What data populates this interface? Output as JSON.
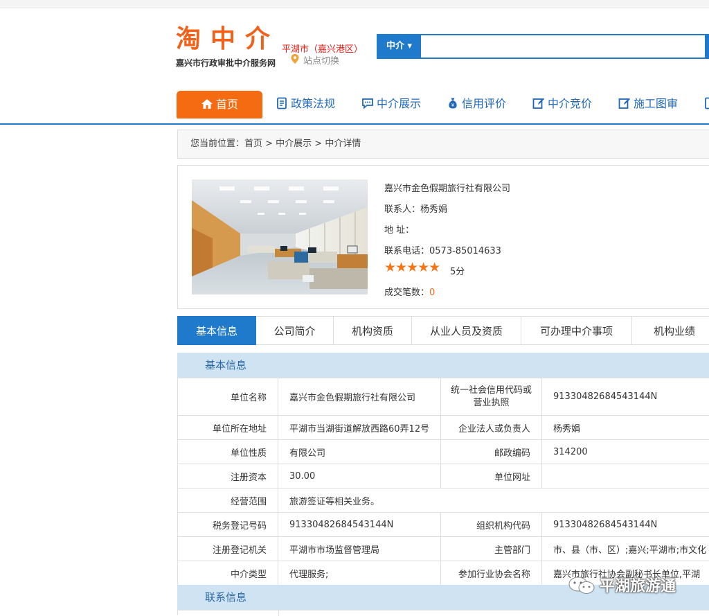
{
  "header": {
    "logo_title": "淘中介",
    "logo_subtitle": "嘉兴市行政审批中介服务网",
    "city": "平湖市（嘉兴港区）",
    "site_switch": "站点切换"
  },
  "search": {
    "type_label": "中介 ▾",
    "placeholder": ""
  },
  "nav": {
    "items": [
      {
        "label": "首页",
        "icon": "home-icon"
      },
      {
        "label": "政策法规",
        "icon": "document-icon"
      },
      {
        "label": "中介展示",
        "icon": "chat-icon"
      },
      {
        "label": "信用评价",
        "icon": "money-bag-icon"
      },
      {
        "label": "中介竞价",
        "icon": "edit-icon"
      },
      {
        "label": "施工图审",
        "icon": "edit-icon"
      }
    ]
  },
  "breadcrumb": "您当前位置：首页 > 中介展示 > 中介详情",
  "company": {
    "name": "嘉兴市金色假期旅行社有限公司",
    "contact": "联系人：杨秀娟",
    "address": "地 址：",
    "phone": "联系电话：0573-85014633",
    "stars": "★★★★★",
    "score": "5分",
    "deals_label": "成交笔数：",
    "deals_value": "0"
  },
  "tabs": [
    "基本信息",
    "公司简介",
    "机构资质",
    "从业人员及资质",
    "可办理中介事项",
    "机构业绩"
  ],
  "sections": {
    "basic": "基本信息",
    "contact": "联系信息"
  },
  "table": {
    "unit_name_label": "单位名称",
    "unit_name": "嘉兴市金色假期旅行社有限公司",
    "credit_code_label": "统一社会信用代码或营业执照",
    "credit_code": "91330482684543144N",
    "address_label": "单位所在地址",
    "address": "平湖市当湖街道解放西路60弄12号",
    "legal_label": "企业法人或负责人",
    "legal": "杨秀娟",
    "nature_label": "单位性质",
    "nature": "有限公司",
    "postcode_label": "邮政编码",
    "postcode": "314200",
    "capital_label": "注册资本",
    "capital": "30.00",
    "website_label": "单位网址",
    "website": "",
    "scope_label": "经营范围",
    "scope": "旅游签证等相关业务。",
    "tax_label": "税务登记号码",
    "tax": "91330482684543144N",
    "org_code_label": "组织机构代码",
    "org_code": "91330482684543144N",
    "reg_org_label": "注册登记机关",
    "reg_org": "平湖市市场监督管理局",
    "dept_label": "主管部门",
    "dept": "市、县（市、区）;嘉兴;平湖市;市文化",
    "type_label": "中介类型",
    "type": "代理服务;",
    "assoc_label": "参加行业协会名称",
    "assoc": "嘉兴市旅行社协会副秘书长单位,平湖"
  },
  "watermark": "平湖旅游通",
  "colors": {
    "brand_orange": "#f46b12",
    "brand_blue": "#1f7acb",
    "section_bg": "#cfe3f3",
    "star": "#f57619"
  }
}
